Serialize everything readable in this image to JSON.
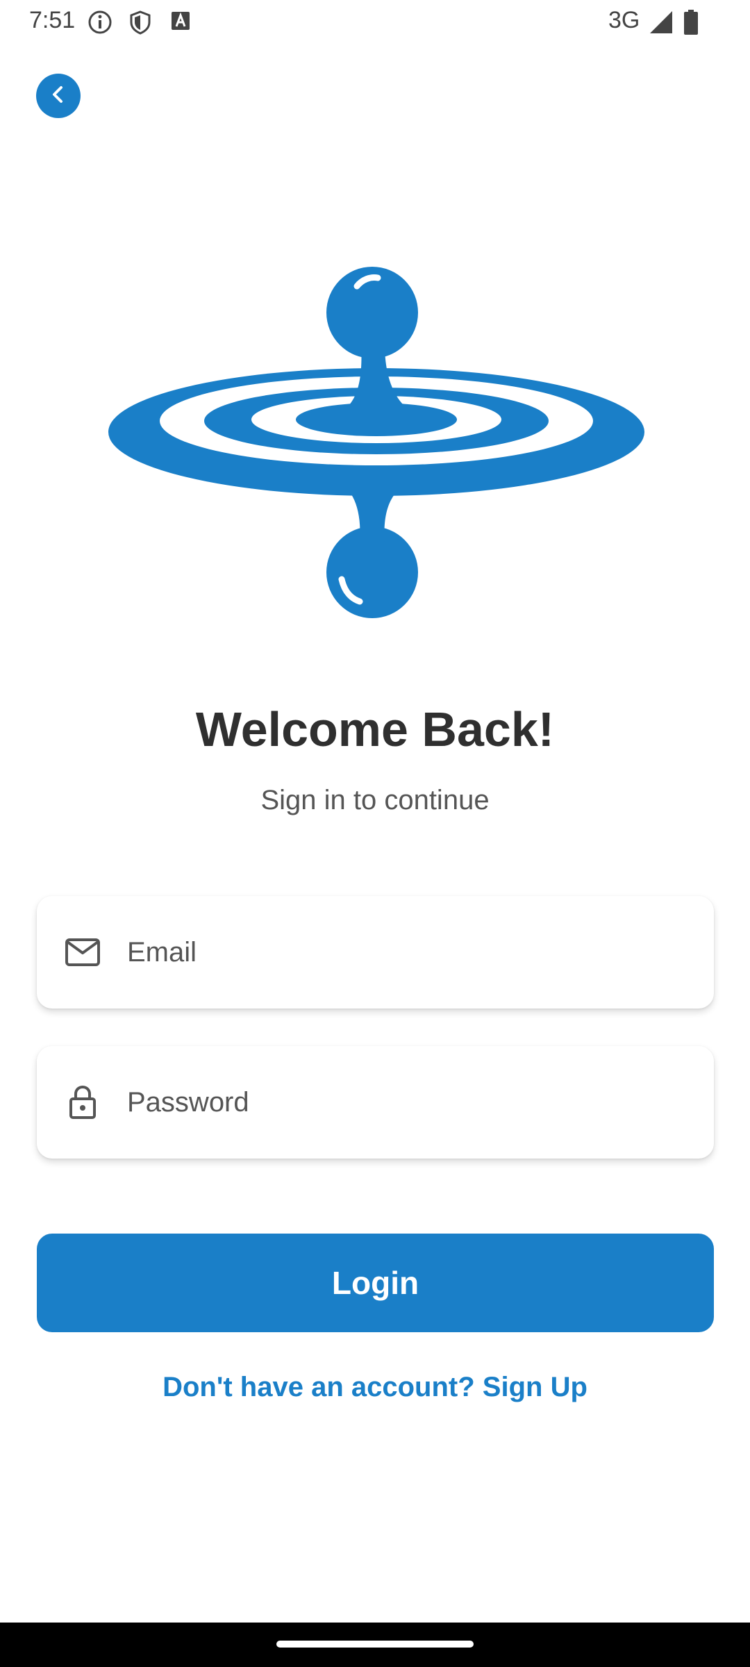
{
  "status_bar": {
    "time": "7:51",
    "network": "3G",
    "icons": [
      "info-icon",
      "shield-icon",
      "keyboard-icon",
      "signal-icon",
      "battery-icon"
    ]
  },
  "header": {
    "back_icon": "chevron-left-icon"
  },
  "logo": {
    "name": "water-drop-ripple-logo",
    "color": "#1a7fc8"
  },
  "welcome": {
    "title": "Welcome Back!",
    "subtitle": "Sign in to continue"
  },
  "form": {
    "email": {
      "placeholder": "Email",
      "value": "",
      "icon": "mail-icon"
    },
    "password": {
      "placeholder": "Password",
      "value": "",
      "icon": "lock-icon"
    },
    "login_label": "Login",
    "signup_text": "Don't have an account? Sign Up"
  },
  "colors": {
    "accent": "#1a7fc8",
    "title": "#2f2f2f",
    "subtitle": "#555555",
    "background": "#ffffff"
  }
}
